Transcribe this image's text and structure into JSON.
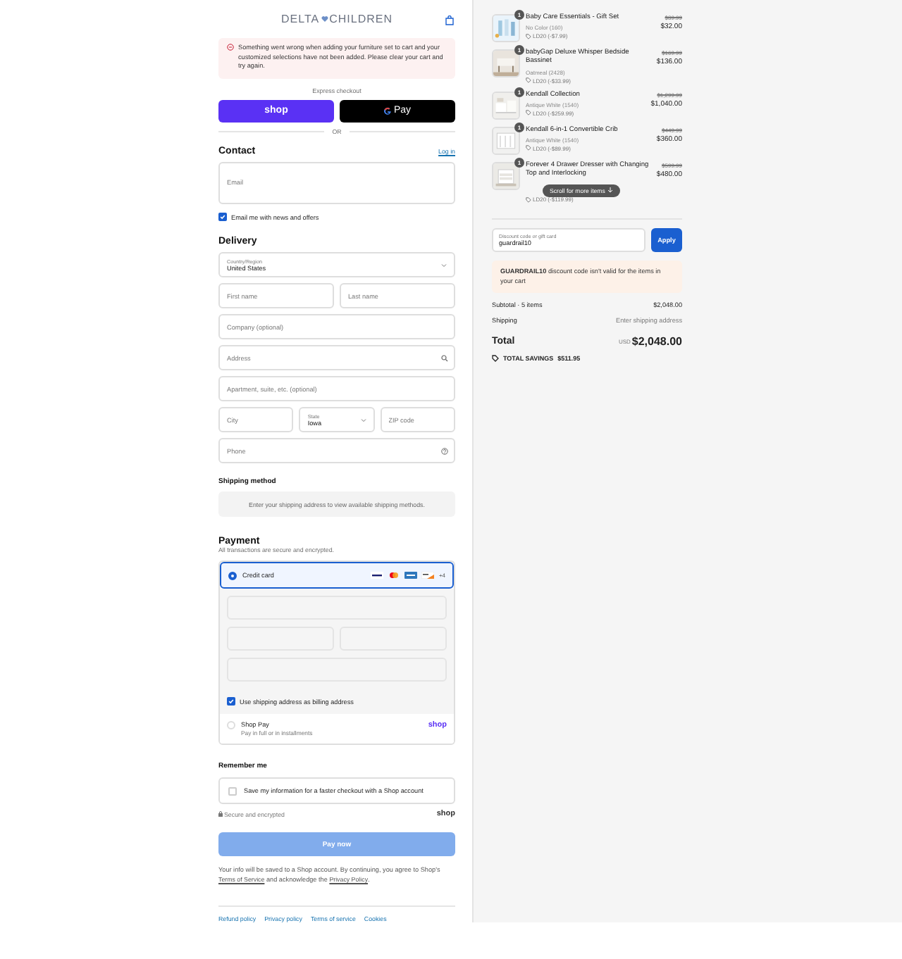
{
  "header": {
    "logo_left": "DELTA",
    "logo_right": "CHILDREN"
  },
  "alert": {
    "message": "Something went wrong when adding your furniture set to cart and your customized selections have not been added. Please clear your cart and try again."
  },
  "express_checkout": {
    "label": "Express checkout",
    "buttons": [
      {
        "kind": "shop",
        "label": "shop"
      },
      {
        "kind": "gpay",
        "label": "Pay"
      }
    ],
    "divider": "OR"
  },
  "contact": {
    "title": "Contact",
    "login": "Log in",
    "email": {
      "placeholder": "Email"
    },
    "newsletter": {
      "label": "Email me with news and offers",
      "checked": true
    }
  },
  "delivery": {
    "title": "Delivery",
    "rows": [
      [
        {
          "kind": "select",
          "label": "Country/Region",
          "value": "United States"
        }
      ],
      [
        {
          "kind": "text",
          "placeholder": "First name"
        },
        {
          "kind": "text",
          "placeholder": "Last name"
        }
      ],
      [
        {
          "kind": "text",
          "placeholder": "Company (optional)"
        }
      ],
      [
        {
          "kind": "search",
          "placeholder": "Address"
        }
      ],
      [
        {
          "kind": "text",
          "placeholder": "Apartment, suite, etc. (optional)"
        }
      ],
      [
        {
          "kind": "text",
          "placeholder": "City"
        },
        {
          "kind": "select",
          "label": "State",
          "value": "Iowa"
        },
        {
          "kind": "text",
          "placeholder": "ZIP code"
        }
      ],
      [
        {
          "kind": "help",
          "placeholder": "Phone"
        }
      ]
    ]
  },
  "shipping_method": {
    "title": "Shipping method",
    "notice": "Enter your shipping address to view available shipping methods."
  },
  "payment": {
    "title": "Payment",
    "subtitle": "All transactions are secure and encrypted.",
    "methods": [
      {
        "kind": "card",
        "label": "Credit card",
        "selected": true,
        "more": "+4"
      },
      {
        "kind": "shoppay",
        "label": "Shop Pay",
        "sublabel": "Pay in full or in installments",
        "brand": "shop",
        "selected": false
      }
    ],
    "billing": {
      "label": "Use shipping address as billing address",
      "checked": true
    }
  },
  "remember": {
    "title": "Remember me",
    "save": {
      "label": "Save my information for a faster checkout with a Shop account",
      "checked": false
    },
    "secure": "Secure and encrypted",
    "brand": "shop"
  },
  "pay_button": {
    "label": "Pay now",
    "disabled": true
  },
  "legal": [
    {
      "kind": "text",
      "text": "Your info will be saved to a Shop account. By continuing, you agree to Shop's "
    },
    {
      "kind": "link",
      "text": "Terms of Service"
    },
    {
      "kind": "text",
      "text": " and acknowledge the "
    },
    {
      "kind": "link",
      "text": "Privacy Policy"
    },
    {
      "kind": "text",
      "text": "."
    }
  ],
  "footer_links": [
    "Refund policy",
    "Privacy policy",
    "Terms of service",
    "Cookies"
  ],
  "cart": {
    "items": [
      {
        "quantity": "1",
        "title": "Baby Care Essentials - Gift Set",
        "variant": "No Color (160)",
        "discount": "LD20 (-$7.99)",
        "original": "$39.99",
        "price": "$32.00"
      },
      {
        "quantity": "1",
        "title": "babyGap Deluxe Whisper Bedside Bassinet",
        "variant": "Oatmeal (2428)",
        "discount": "LD20 (-$33.99)",
        "original": "$169.99",
        "price": "$136.00"
      },
      {
        "quantity": "1",
        "title": "Kendall Collection",
        "variant": "Antique White (1540)",
        "discount": "LD20 (-$259.99)",
        "original": "$1,299.99",
        "price": "$1,040.00"
      },
      {
        "quantity": "1",
        "title": "Kendall 6-in-1 Convertible Crib",
        "variant": "Antique White (1540)",
        "discount": "LD20 (-$89.99)",
        "original": "$449.99",
        "price": "$360.00"
      },
      {
        "quantity": "1",
        "title": "Forever 4 Drawer Dresser with Changing Top and Interlocking",
        "discount": "LD20 (-$119.99)",
        "original": "$599.99",
        "price": "$480.00",
        "covered": true
      }
    ],
    "scroll_hint": "Scroll for more items",
    "discount": {
      "placeholder": "Discount code or gift card",
      "value": "guardrail10",
      "apply": "Apply"
    },
    "discount_error": "**GUARDRAIL10** discount code isn't valid for the items in your cart",
    "summary": [
      {
        "label": "Subtotal · 5 items",
        "value": "$2,048.00",
        "kind": "amount"
      },
      {
        "label": "Shipping",
        "value": "Enter shipping address",
        "kind": "note"
      }
    ],
    "total": {
      "label": "Total",
      "currency": "USD",
      "value": "$2,048.00"
    },
    "savings": {
      "label": "TOTAL SAVINGS",
      "value": "$511.95"
    }
  }
}
